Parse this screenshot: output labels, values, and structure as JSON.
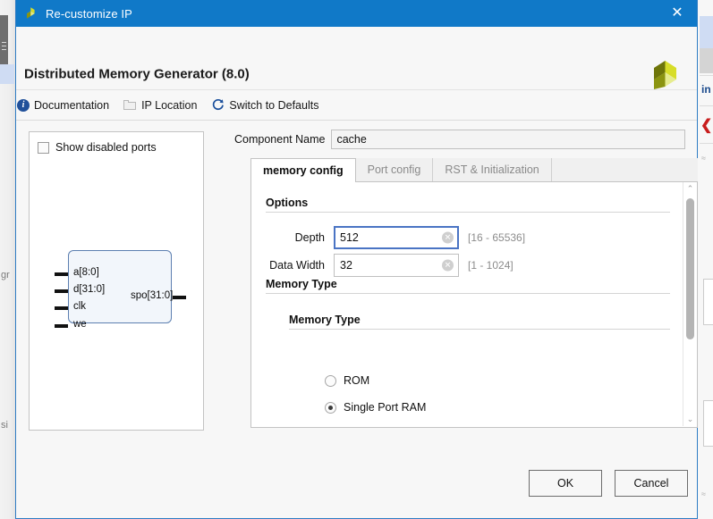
{
  "background": {
    "left_text_1": "gr",
    "left_text_2": "si",
    "right_text": "in",
    "right_chevron": "❮"
  },
  "titlebar": {
    "title": "Re-customize IP",
    "close_label": "✕",
    "logo_name": "xilinx-logo",
    "bg_color": "#1079c8"
  },
  "header": {
    "title": "Distributed Memory Generator (8.0)",
    "logo_name": "xilinx-pinwheel-logo"
  },
  "toolbar": {
    "items": [
      {
        "label": "Documentation",
        "icon": "info-icon",
        "disabled": false
      },
      {
        "label": "IP Location",
        "icon": "folder-icon",
        "disabled": true
      },
      {
        "label": "Switch to Defaults",
        "icon": "refresh-icon",
        "disabled": false
      }
    ]
  },
  "symbol_panel": {
    "show_disabled_ports_label": "Show disabled ports",
    "show_disabled_ports_checked": false,
    "input_ports": [
      "a[8:0]",
      "d[31:0]",
      "clk",
      "we"
    ],
    "output_ports": [
      "spo[31:0]"
    ]
  },
  "component": {
    "label": "Component Name",
    "value": "cache"
  },
  "tabs": [
    {
      "label": "memory config",
      "active": true
    },
    {
      "label": "Port config",
      "active": false
    },
    {
      "label": "RST & Initialization",
      "active": false
    }
  ],
  "options_section": {
    "title": "Options",
    "fields": [
      {
        "label": "Depth",
        "value": "512",
        "range": "[16 - 65536]",
        "focused": true,
        "clear_glyph": "✕"
      },
      {
        "label": "Data Width",
        "value": "32",
        "range": "[1 - 1024]",
        "focused": false,
        "clear_glyph": "✕"
      }
    ]
  },
  "memory_type_section": {
    "title": "Memory Type",
    "inner_title": "Memory Type",
    "options": [
      {
        "label": "ROM",
        "checked": false
      },
      {
        "label": "Single Port RAM",
        "checked": true
      }
    ]
  },
  "scrollbar": {
    "up_glyph": "⌃",
    "down_glyph": "⌄"
  },
  "footer": {
    "ok_label": "OK",
    "cancel_label": "Cancel"
  }
}
